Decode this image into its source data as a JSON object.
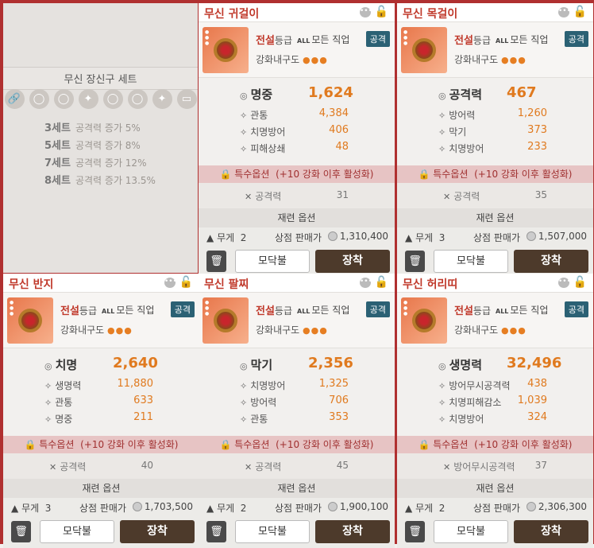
{
  "set": {
    "title": "무신 장신구 세트",
    "slots": [
      "🔗",
      "◯",
      "◯",
      "✦",
      "◯",
      "◯",
      "✦",
      "▭"
    ],
    "bonuses": [
      {
        "count": "3세트",
        "desc": "공격력 증가 5%"
      },
      {
        "count": "5세트",
        "desc": "공격력 증가 8%"
      },
      {
        "count": "7세트",
        "desc": "공격력 증가 12%"
      },
      {
        "count": "8세트",
        "desc": "공격력 증가 13.5%"
      }
    ]
  },
  "common": {
    "tier_label": "전설",
    "tier_suffix": "등급",
    "job_prefix": "ALL",
    "job": "모든 직업",
    "badge": "공격",
    "durability_label": "강화내구도",
    "durability_dots": "●●●",
    "special_label": "특수옵션",
    "special_desc": "(+10 강화 이후 활성화)",
    "reroll": "재련 옵션",
    "weight_label": "무게",
    "sell_label": "상점 판매가",
    "button_secondary": "모닥불",
    "button_primary": "장착"
  },
  "items": [
    {
      "name": "무신 귀걸이",
      "main_stat": "명중",
      "main_value": "1,624",
      "subs": [
        {
          "label": "관통",
          "value": "4,384"
        },
        {
          "label": "치명방어",
          "value": "406"
        },
        {
          "label": "피해상쇄",
          "value": "48"
        }
      ],
      "opt_label": "공격력",
      "opt_value": "31",
      "weight": "2",
      "price": "1,310,400"
    },
    {
      "name": "무신 목걸이",
      "main_stat": "공격력",
      "main_value": "467",
      "subs": [
        {
          "label": "방어력",
          "value": "1,260"
        },
        {
          "label": "막기",
          "value": "373"
        },
        {
          "label": "치명방어",
          "value": "233"
        }
      ],
      "opt_label": "공격력",
      "opt_value": "35",
      "weight": "3",
      "price": "1,507,000"
    },
    {
      "name": "무신 반지",
      "main_stat": "치명",
      "main_value": "2,640",
      "subs": [
        {
          "label": "생명력",
          "value": "11,880"
        },
        {
          "label": "관통",
          "value": "633"
        },
        {
          "label": "명중",
          "value": "211"
        }
      ],
      "opt_label": "공격력",
      "opt_value": "40",
      "weight": "3",
      "price": "1,703,500"
    },
    {
      "name": "무신 팔찌",
      "main_stat": "막기",
      "main_value": "2,356",
      "subs": [
        {
          "label": "치명방어",
          "value": "1,325"
        },
        {
          "label": "방어력",
          "value": "706"
        },
        {
          "label": "관통",
          "value": "353"
        }
      ],
      "opt_label": "공격력",
      "opt_value": "45",
      "weight": "2",
      "price": "1,900,100"
    },
    {
      "name": "무신 허리띠",
      "main_stat": "생명력",
      "main_value": "32,496",
      "subs": [
        {
          "label": "방어무시공격력",
          "value": "438"
        },
        {
          "label": "치명피해감소",
          "value": "1,039"
        },
        {
          "label": "치명방어",
          "value": "324"
        }
      ],
      "opt_label": "방어무시공격력",
      "opt_value": "37",
      "weight": "2",
      "price": "2,306,300"
    }
  ]
}
